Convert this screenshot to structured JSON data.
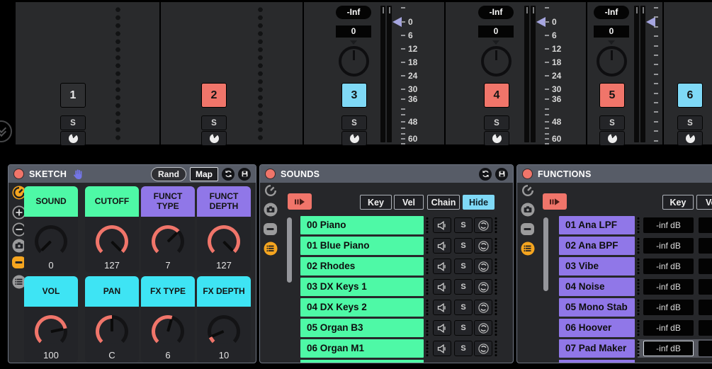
{
  "colors": {
    "salmon": "#f0756a",
    "cyan": "#7fd9f6",
    "green": "#4ef9a6",
    "purple": "#9077e8",
    "macro_cyan": "#3ee4f4",
    "orange": "#f5a51f",
    "lavender": "#a6a6e0",
    "hand_purple": "#7476e8"
  },
  "mixer": {
    "meter_labels": [
      "0",
      "6",
      "12",
      "18",
      "24",
      "30",
      "36",
      "48",
      "60"
    ],
    "tracks": [
      {
        "number": "1",
        "accent": "none",
        "solo": "S",
        "variant": "group"
      },
      {
        "number": "2",
        "accent": "salmon",
        "solo": "S",
        "variant": "group"
      },
      {
        "number": "3",
        "accent": "cyan",
        "solo": "S",
        "variant": "full",
        "volume": "-Inf",
        "value": "0"
      },
      {
        "number": "4",
        "accent": "salmon",
        "solo": "S",
        "variant": "full",
        "volume": "-Inf",
        "value": "0"
      },
      {
        "number": "5",
        "accent": "salmon",
        "solo": "S",
        "variant": "compact",
        "volume": "-Inf",
        "value": "0"
      },
      {
        "number": "6",
        "accent": "cyan",
        "solo": "S",
        "variant": "buttons"
      }
    ]
  },
  "devices": {
    "sketch": {
      "title": "SKETCH",
      "rand_label": "Rand",
      "map_label": "Map",
      "side_icons": [
        {
          "icon": "macro-knob",
          "active": true
        },
        {
          "icon": "add-macro",
          "active": false
        },
        {
          "icon": "remove-macro",
          "active": false
        },
        {
          "icon": "variations-camera",
          "active": false
        },
        {
          "icon": "devices",
          "active": true
        },
        {
          "icon": "chain-list",
          "active": false
        }
      ],
      "macros": [
        {
          "label": "SOUND",
          "color": "green",
          "value": "0",
          "fraction": 0
        },
        {
          "label": "CUTOFF",
          "color": "green",
          "value": "127",
          "fraction": 1
        },
        {
          "label": "FUNCT TYPE",
          "color": "purple",
          "value": "7",
          "fraction": 0.67
        },
        {
          "label": "FUNCT DEPTH",
          "color": "purple",
          "value": "127",
          "fraction": 1
        },
        {
          "label": "VOL",
          "color": "macro_cyan",
          "value": "100",
          "fraction": 0.79
        },
        {
          "label": "PAN",
          "color": "macro_cyan",
          "value": "C",
          "fraction": 0.5
        },
        {
          "label": "FX TYPE",
          "color": "macro_cyan",
          "value": "6",
          "fraction": 0.56
        },
        {
          "label": "FX DEPTH",
          "color": "macro_cyan",
          "value": "10",
          "fraction": 0.08
        }
      ]
    },
    "sounds": {
      "title": "SOUNDS",
      "side_icons": [
        {
          "icon": "macro-knob",
          "active": false
        },
        {
          "icon": "variations-camera",
          "active": false
        },
        {
          "icon": "devices",
          "active": false
        },
        {
          "icon": "chain-list",
          "active": true
        }
      ],
      "tabs": [
        {
          "label": "Key",
          "active": false
        },
        {
          "label": "Vel",
          "active": false
        },
        {
          "label": "Chain",
          "active": false
        },
        {
          "label": "Hide",
          "active": true
        }
      ],
      "chains": [
        {
          "name": "00 Piano"
        },
        {
          "name": "01 Blue Piano"
        },
        {
          "name": "02 Rhodes"
        },
        {
          "name": "03 DX Keys 1"
        },
        {
          "name": "04 DX Keys 2"
        },
        {
          "name": "05 Organ B3"
        },
        {
          "name": "06 Organ M1"
        }
      ]
    },
    "functions": {
      "title": "FUNCTIONS",
      "side_icons": [
        {
          "icon": "macro-knob",
          "active": false
        },
        {
          "icon": "variations-camera",
          "active": false
        },
        {
          "icon": "devices",
          "active": false
        },
        {
          "icon": "chain-list",
          "active": true
        }
      ],
      "tabs": [
        {
          "label": "Key",
          "active": false
        },
        {
          "label": "Vel",
          "active": false
        }
      ],
      "chains": [
        {
          "name": "01 Ana LPF",
          "volume": "-inf dB",
          "selected": false
        },
        {
          "name": "02 Ana BPF",
          "volume": "-inf dB",
          "selected": false
        },
        {
          "name": "03 Vibe",
          "volume": "-inf dB",
          "selected": false
        },
        {
          "name": "04 Noise",
          "volume": "-inf dB",
          "selected": false
        },
        {
          "name": "05 Mono Stab",
          "volume": "-inf dB",
          "selected": false
        },
        {
          "name": "06 Hoover",
          "volume": "-inf dB",
          "selected": false
        },
        {
          "name": "07 Pad Maker",
          "volume": "-inf dB",
          "selected": true
        }
      ]
    }
  }
}
